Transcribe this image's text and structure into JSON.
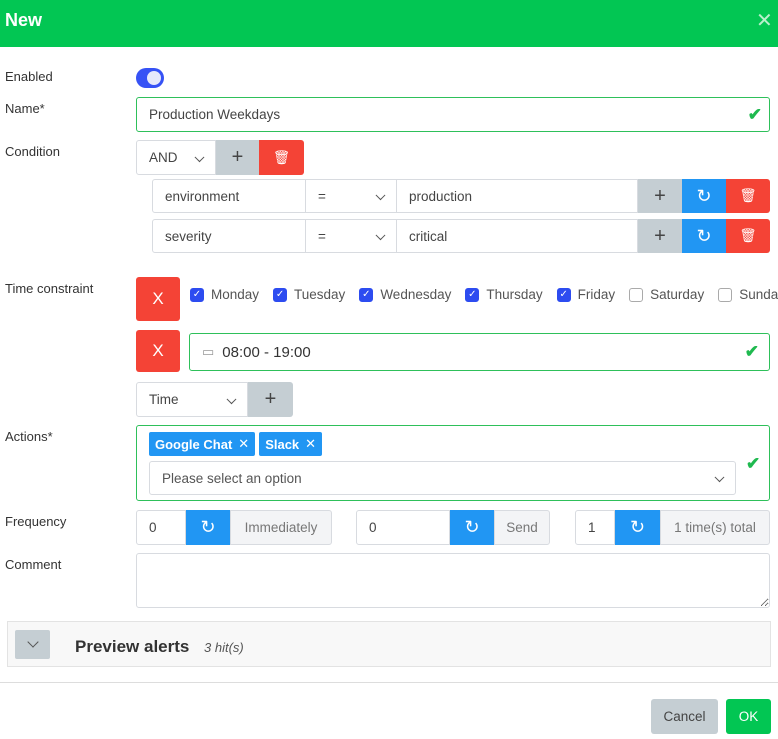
{
  "header": {
    "title": "New",
    "close_icon": "close-icon"
  },
  "labels": {
    "enabled": "Enabled",
    "name": "Name*",
    "condition": "Condition",
    "time_constraint": "Time constraint",
    "actions": "Actions*",
    "frequency": "Frequency",
    "comment": "Comment"
  },
  "enabled": true,
  "name_value": "Production Weekdays",
  "condition": {
    "operator": "AND",
    "rows": [
      {
        "field": "environment",
        "op": "=",
        "value": "production"
      },
      {
        "field": "severity",
        "op": "=",
        "value": "critical"
      }
    ]
  },
  "time_constraint": {
    "remove_label": "X",
    "days": [
      {
        "label": "Monday",
        "checked": true
      },
      {
        "label": "Tuesday",
        "checked": true
      },
      {
        "label": "Wednesday",
        "checked": true
      },
      {
        "label": "Thursday",
        "checked": true
      },
      {
        "label": "Friday",
        "checked": true
      },
      {
        "label": "Saturday",
        "checked": false
      },
      {
        "label": "Sunday",
        "checked": false
      }
    ],
    "time_range": "08:00 - 19:00",
    "type_select": "Time"
  },
  "actions": {
    "tags": [
      "Google Chat",
      "Slack"
    ],
    "placeholder": "Please select an option"
  },
  "frequency": [
    {
      "value": "0",
      "addon": "Immediately"
    },
    {
      "value": "0",
      "addon": "Send"
    },
    {
      "value": "1",
      "addon": "1 time(s) total"
    }
  ],
  "comment": "",
  "preview": {
    "title": "Preview alerts",
    "hits": "3 hit(s)"
  },
  "footer": {
    "cancel": "Cancel",
    "ok": "OK"
  },
  "colors": {
    "header": "#02c653",
    "primary": "#2196f3",
    "danger": "#f44336",
    "toggle": "#3652f5"
  }
}
